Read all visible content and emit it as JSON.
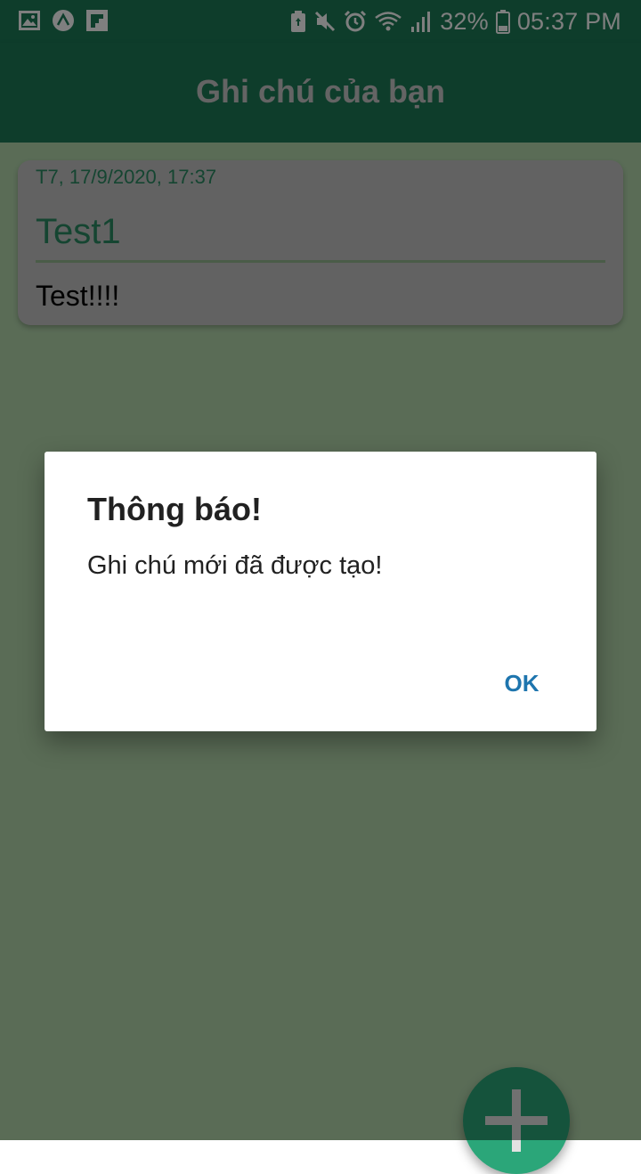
{
  "status_bar": {
    "battery_percent": "32%",
    "time": "05:37 PM",
    "left_icons": [
      "gallery-icon",
      "expo-icon",
      "flipboard-icon"
    ],
    "right_icons": [
      "battery-saver-icon",
      "mute-icon",
      "alarm-icon",
      "wifi-icon",
      "signal-icon",
      "battery-icon"
    ]
  },
  "app_bar": {
    "title": "Ghi chú của bạn"
  },
  "notes": [
    {
      "date": "T7, 17/9/2020, 17:37",
      "title": "Test1",
      "body": "Test!!!!"
    }
  ],
  "fab": {
    "icon": "plus-icon"
  },
  "dialog": {
    "title": "Thông báo!",
    "message": "Ghi chú mới đã được tạo!",
    "ok_label": "OK"
  },
  "colors": {
    "primary": "#1c7a57",
    "accent": "#2ba679",
    "dialog_button": "#1e75ae"
  }
}
